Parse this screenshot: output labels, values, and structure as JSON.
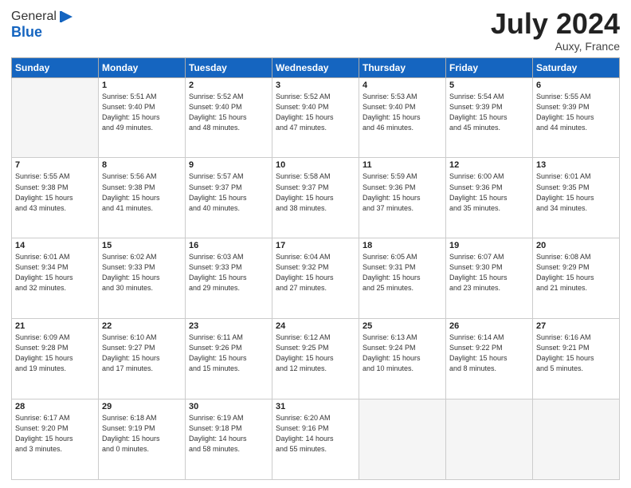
{
  "logo": {
    "general": "General",
    "blue": "Blue"
  },
  "title": {
    "month_year": "July 2024",
    "location": "Auxy, France"
  },
  "days_of_week": [
    "Sunday",
    "Monday",
    "Tuesday",
    "Wednesday",
    "Thursday",
    "Friday",
    "Saturday"
  ],
  "weeks": [
    [
      {
        "num": "",
        "sunrise": "",
        "sunset": "",
        "daylight": "",
        "empty": true
      },
      {
        "num": "1",
        "sunrise": "Sunrise: 5:51 AM",
        "sunset": "Sunset: 9:40 PM",
        "daylight": "Daylight: 15 hours",
        "extra": "and 49 minutes."
      },
      {
        "num": "2",
        "sunrise": "Sunrise: 5:52 AM",
        "sunset": "Sunset: 9:40 PM",
        "daylight": "Daylight: 15 hours",
        "extra": "and 48 minutes."
      },
      {
        "num": "3",
        "sunrise": "Sunrise: 5:52 AM",
        "sunset": "Sunset: 9:40 PM",
        "daylight": "Daylight: 15 hours",
        "extra": "and 47 minutes."
      },
      {
        "num": "4",
        "sunrise": "Sunrise: 5:53 AM",
        "sunset": "Sunset: 9:40 PM",
        "daylight": "Daylight: 15 hours",
        "extra": "and 46 minutes."
      },
      {
        "num": "5",
        "sunrise": "Sunrise: 5:54 AM",
        "sunset": "Sunset: 9:39 PM",
        "daylight": "Daylight: 15 hours",
        "extra": "and 45 minutes."
      },
      {
        "num": "6",
        "sunrise": "Sunrise: 5:55 AM",
        "sunset": "Sunset: 9:39 PM",
        "daylight": "Daylight: 15 hours",
        "extra": "and 44 minutes."
      }
    ],
    [
      {
        "num": "7",
        "sunrise": "Sunrise: 5:55 AM",
        "sunset": "Sunset: 9:38 PM",
        "daylight": "Daylight: 15 hours",
        "extra": "and 43 minutes."
      },
      {
        "num": "8",
        "sunrise": "Sunrise: 5:56 AM",
        "sunset": "Sunset: 9:38 PM",
        "daylight": "Daylight: 15 hours",
        "extra": "and 41 minutes."
      },
      {
        "num": "9",
        "sunrise": "Sunrise: 5:57 AM",
        "sunset": "Sunset: 9:37 PM",
        "daylight": "Daylight: 15 hours",
        "extra": "and 40 minutes."
      },
      {
        "num": "10",
        "sunrise": "Sunrise: 5:58 AM",
        "sunset": "Sunset: 9:37 PM",
        "daylight": "Daylight: 15 hours",
        "extra": "and 38 minutes."
      },
      {
        "num": "11",
        "sunrise": "Sunrise: 5:59 AM",
        "sunset": "Sunset: 9:36 PM",
        "daylight": "Daylight: 15 hours",
        "extra": "and 37 minutes."
      },
      {
        "num": "12",
        "sunrise": "Sunrise: 6:00 AM",
        "sunset": "Sunset: 9:36 PM",
        "daylight": "Daylight: 15 hours",
        "extra": "and 35 minutes."
      },
      {
        "num": "13",
        "sunrise": "Sunrise: 6:01 AM",
        "sunset": "Sunset: 9:35 PM",
        "daylight": "Daylight: 15 hours",
        "extra": "and 34 minutes."
      }
    ],
    [
      {
        "num": "14",
        "sunrise": "Sunrise: 6:01 AM",
        "sunset": "Sunset: 9:34 PM",
        "daylight": "Daylight: 15 hours",
        "extra": "and 32 minutes."
      },
      {
        "num": "15",
        "sunrise": "Sunrise: 6:02 AM",
        "sunset": "Sunset: 9:33 PM",
        "daylight": "Daylight: 15 hours",
        "extra": "and 30 minutes."
      },
      {
        "num": "16",
        "sunrise": "Sunrise: 6:03 AM",
        "sunset": "Sunset: 9:33 PM",
        "daylight": "Daylight: 15 hours",
        "extra": "and 29 minutes."
      },
      {
        "num": "17",
        "sunrise": "Sunrise: 6:04 AM",
        "sunset": "Sunset: 9:32 PM",
        "daylight": "Daylight: 15 hours",
        "extra": "and 27 minutes."
      },
      {
        "num": "18",
        "sunrise": "Sunrise: 6:05 AM",
        "sunset": "Sunset: 9:31 PM",
        "daylight": "Daylight: 15 hours",
        "extra": "and 25 minutes."
      },
      {
        "num": "19",
        "sunrise": "Sunrise: 6:07 AM",
        "sunset": "Sunset: 9:30 PM",
        "daylight": "Daylight: 15 hours",
        "extra": "and 23 minutes."
      },
      {
        "num": "20",
        "sunrise": "Sunrise: 6:08 AM",
        "sunset": "Sunset: 9:29 PM",
        "daylight": "Daylight: 15 hours",
        "extra": "and 21 minutes."
      }
    ],
    [
      {
        "num": "21",
        "sunrise": "Sunrise: 6:09 AM",
        "sunset": "Sunset: 9:28 PM",
        "daylight": "Daylight: 15 hours",
        "extra": "and 19 minutes."
      },
      {
        "num": "22",
        "sunrise": "Sunrise: 6:10 AM",
        "sunset": "Sunset: 9:27 PM",
        "daylight": "Daylight: 15 hours",
        "extra": "and 17 minutes."
      },
      {
        "num": "23",
        "sunrise": "Sunrise: 6:11 AM",
        "sunset": "Sunset: 9:26 PM",
        "daylight": "Daylight: 15 hours",
        "extra": "and 15 minutes."
      },
      {
        "num": "24",
        "sunrise": "Sunrise: 6:12 AM",
        "sunset": "Sunset: 9:25 PM",
        "daylight": "Daylight: 15 hours",
        "extra": "and 12 minutes."
      },
      {
        "num": "25",
        "sunrise": "Sunrise: 6:13 AM",
        "sunset": "Sunset: 9:24 PM",
        "daylight": "Daylight: 15 hours",
        "extra": "and 10 minutes."
      },
      {
        "num": "26",
        "sunrise": "Sunrise: 6:14 AM",
        "sunset": "Sunset: 9:22 PM",
        "daylight": "Daylight: 15 hours",
        "extra": "and 8 minutes."
      },
      {
        "num": "27",
        "sunrise": "Sunrise: 6:16 AM",
        "sunset": "Sunset: 9:21 PM",
        "daylight": "Daylight: 15 hours",
        "extra": "and 5 minutes."
      }
    ],
    [
      {
        "num": "28",
        "sunrise": "Sunrise: 6:17 AM",
        "sunset": "Sunset: 9:20 PM",
        "daylight": "Daylight: 15 hours",
        "extra": "and 3 minutes."
      },
      {
        "num": "29",
        "sunrise": "Sunrise: 6:18 AM",
        "sunset": "Sunset: 9:19 PM",
        "daylight": "Daylight: 15 hours",
        "extra": "and 0 minutes."
      },
      {
        "num": "30",
        "sunrise": "Sunrise: 6:19 AM",
        "sunset": "Sunset: 9:18 PM",
        "daylight": "Daylight: 14 hours",
        "extra": "and 58 minutes."
      },
      {
        "num": "31",
        "sunrise": "Sunrise: 6:20 AM",
        "sunset": "Sunset: 9:16 PM",
        "daylight": "Daylight: 14 hours",
        "extra": "and 55 minutes."
      },
      {
        "num": "",
        "sunrise": "",
        "sunset": "",
        "daylight": "",
        "empty": true
      },
      {
        "num": "",
        "sunrise": "",
        "sunset": "",
        "daylight": "",
        "empty": true
      },
      {
        "num": "",
        "sunrise": "",
        "sunset": "",
        "daylight": "",
        "empty": true
      }
    ]
  ]
}
